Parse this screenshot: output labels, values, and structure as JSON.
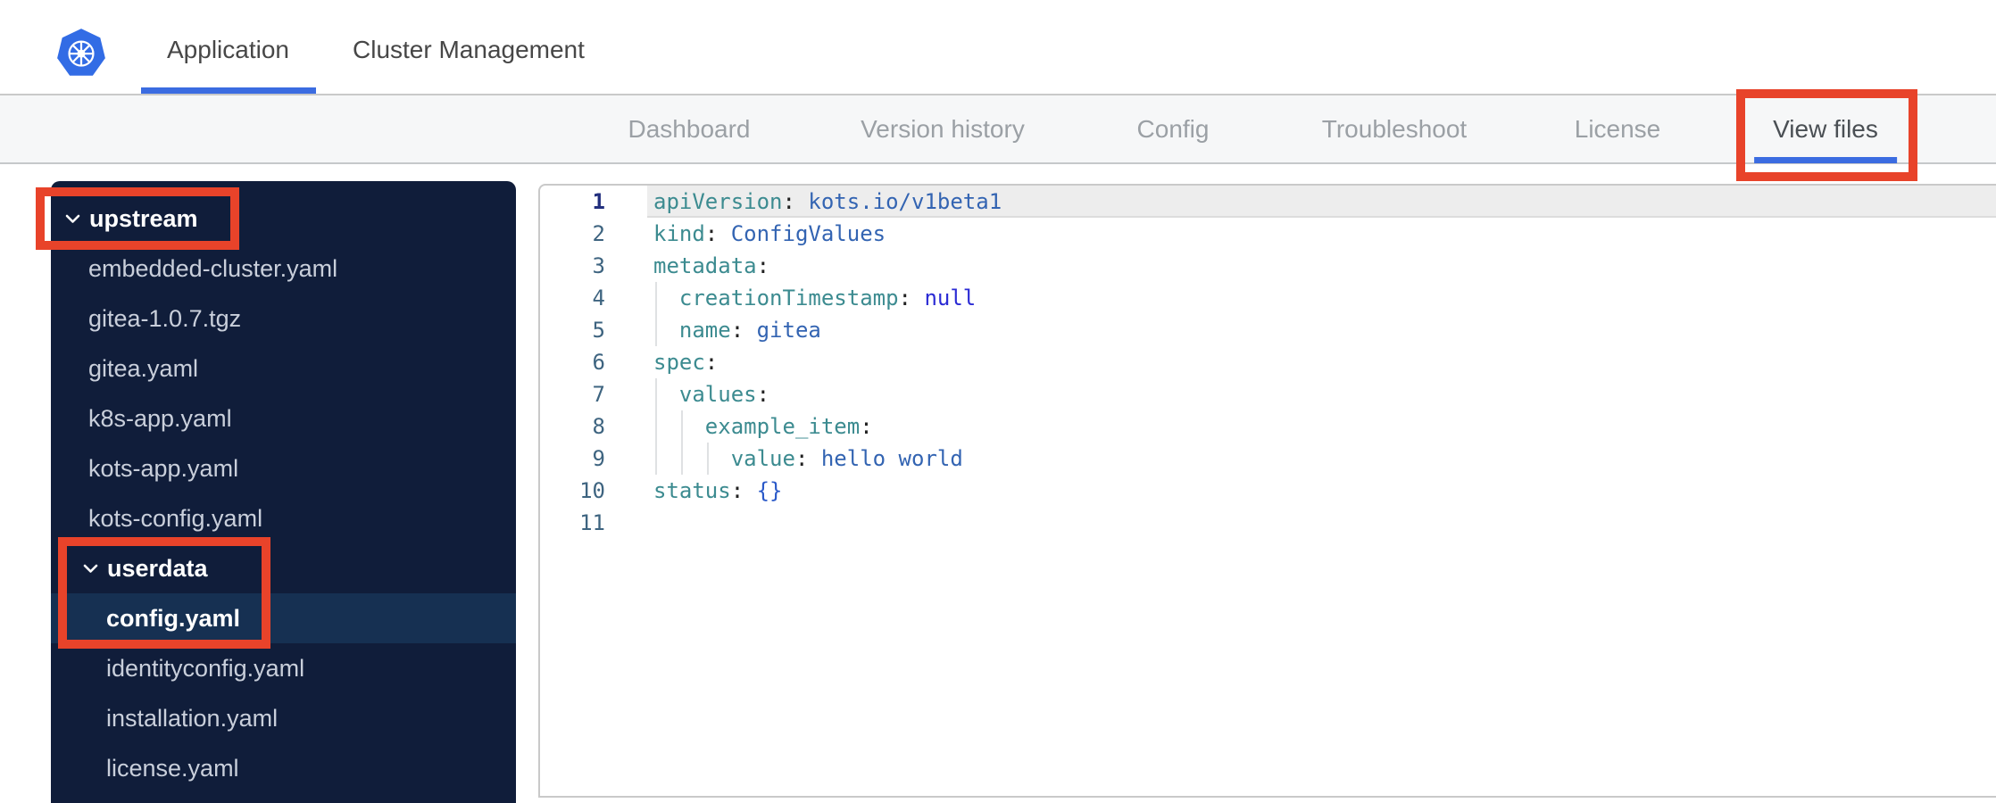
{
  "header": {
    "logo": "kubernetes-logo",
    "tabs": [
      {
        "label": "Application",
        "active": true
      },
      {
        "label": "Cluster Management",
        "active": false
      }
    ]
  },
  "nav": {
    "items": [
      {
        "label": "Dashboard",
        "active": false
      },
      {
        "label": "Version history",
        "active": false
      },
      {
        "label": "Config",
        "active": false
      },
      {
        "label": "Troubleshoot",
        "active": false
      },
      {
        "label": "License",
        "active": false
      },
      {
        "label": "View files",
        "active": true
      }
    ]
  },
  "sidebar": {
    "items": [
      {
        "type": "folder",
        "label": "upstream",
        "level": 0,
        "expanded": true,
        "selected": false
      },
      {
        "type": "file",
        "label": "embedded-cluster.yaml",
        "level": 1,
        "selected": false
      },
      {
        "type": "file",
        "label": "gitea-1.0.7.tgz",
        "level": 1,
        "selected": false
      },
      {
        "type": "file",
        "label": "gitea.yaml",
        "level": 1,
        "selected": false
      },
      {
        "type": "file",
        "label": "k8s-app.yaml",
        "level": 1,
        "selected": false
      },
      {
        "type": "file",
        "label": "kots-app.yaml",
        "level": 1,
        "selected": false
      },
      {
        "type": "file",
        "label": "kots-config.yaml",
        "level": 1,
        "selected": false
      },
      {
        "type": "folder",
        "label": "userdata",
        "level": 1,
        "expanded": true,
        "selected": false
      },
      {
        "type": "file",
        "label": "config.yaml",
        "level": 2,
        "selected": true
      },
      {
        "type": "file",
        "label": "identityconfig.yaml",
        "level": 2,
        "selected": false
      },
      {
        "type": "file",
        "label": "installation.yaml",
        "level": 2,
        "selected": false
      },
      {
        "type": "file",
        "label": "license.yaml",
        "level": 2,
        "selected": false
      }
    ]
  },
  "editor": {
    "language": "yaml",
    "active_line": 1,
    "lines": [
      {
        "num": 1,
        "indent": 0,
        "tokens": [
          [
            "key",
            "apiVersion"
          ],
          [
            "colon",
            ":"
          ],
          [
            "plain",
            " "
          ],
          [
            "val",
            "kots.io/v1beta1"
          ]
        ]
      },
      {
        "num": 2,
        "indent": 0,
        "tokens": [
          [
            "key",
            "kind"
          ],
          [
            "colon",
            ":"
          ],
          [
            "plain",
            " "
          ],
          [
            "val",
            "ConfigValues"
          ]
        ]
      },
      {
        "num": 3,
        "indent": 0,
        "tokens": [
          [
            "key",
            "metadata"
          ],
          [
            "colon",
            ":"
          ]
        ]
      },
      {
        "num": 4,
        "indent": 2,
        "tokens": [
          [
            "plain",
            "  "
          ],
          [
            "key",
            "creationTimestamp"
          ],
          [
            "colon",
            ":"
          ],
          [
            "plain",
            " "
          ],
          [
            "null",
            "null"
          ]
        ]
      },
      {
        "num": 5,
        "indent": 2,
        "tokens": [
          [
            "plain",
            "  "
          ],
          [
            "key",
            "name"
          ],
          [
            "colon",
            ":"
          ],
          [
            "plain",
            " "
          ],
          [
            "val",
            "gitea"
          ]
        ]
      },
      {
        "num": 6,
        "indent": 0,
        "tokens": [
          [
            "key",
            "spec"
          ],
          [
            "colon",
            ":"
          ]
        ]
      },
      {
        "num": 7,
        "indent": 2,
        "tokens": [
          [
            "plain",
            "  "
          ],
          [
            "key",
            "values"
          ],
          [
            "colon",
            ":"
          ]
        ]
      },
      {
        "num": 8,
        "indent": 4,
        "tokens": [
          [
            "plain",
            "    "
          ],
          [
            "key",
            "example_item"
          ],
          [
            "colon",
            ":"
          ]
        ]
      },
      {
        "num": 9,
        "indent": 6,
        "tokens": [
          [
            "plain",
            "      "
          ],
          [
            "key",
            "value"
          ],
          [
            "colon",
            ":"
          ],
          [
            "plain",
            " "
          ],
          [
            "val",
            "hello world"
          ]
        ]
      },
      {
        "num": 10,
        "indent": 0,
        "tokens": [
          [
            "key",
            "status"
          ],
          [
            "colon",
            ":"
          ],
          [
            "plain",
            " "
          ],
          [
            "brace",
            "{}"
          ]
        ]
      },
      {
        "num": 11,
        "indent": 0,
        "tokens": []
      }
    ]
  },
  "annotations": [
    {
      "name": "view-files-tab-highlight",
      "target": "View files",
      "color": "#e8432a"
    },
    {
      "name": "upstream-folder-highlight",
      "target": "upstream",
      "color": "#e8432a"
    },
    {
      "name": "userdata-config-highlight",
      "target": "userdata / config.yaml",
      "color": "#e8432a"
    }
  ],
  "colors": {
    "accent_blue": "#326ce5",
    "tab_underline": "#3b6ce1",
    "annotation_red": "#e8432a",
    "sidebar_bg": "#101d3a",
    "sidebar_selected_bg": "#163052",
    "code_key": "#3c8b90",
    "code_value": "#3364b2",
    "code_null": "#2b2bd4",
    "gutter_number": "#3e6480"
  }
}
